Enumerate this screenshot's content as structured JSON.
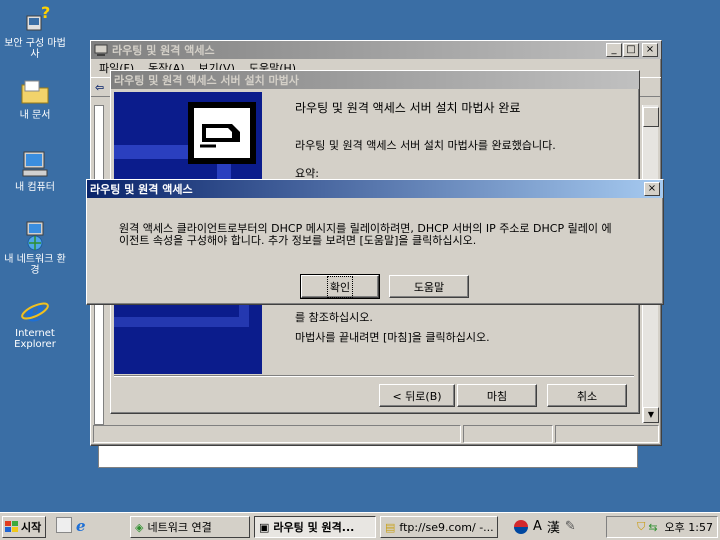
{
  "desktop": {
    "icons": [
      {
        "label": "보안 구성 마법사"
      },
      {
        "label": "내 문서"
      },
      {
        "label": "내 컴퓨터"
      },
      {
        "label": "내 네트워크 환경"
      },
      {
        "label": "Internet Explorer"
      }
    ]
  },
  "main_window": {
    "title": "라우팅 및 원격 액세스",
    "menu": [
      "파일(F)",
      "동작(A)",
      "보기(V)",
      "도움말(H)"
    ]
  },
  "wizard": {
    "title": "라우팅 및 원격 액세스 서버 설치 마법사",
    "heading": "라우팅 및 원격 액세스 서버 설치 마법사 완료",
    "completed_text": "라우팅 및 원격 액세스 서버 설치 마법사를 완료했습니다.",
    "summary_label": "요약:",
    "partial_line": "를 참조하십시오.",
    "close_text": "마법사를 끝내려면 [마침]을 클릭하십시오.",
    "back_button": "< 뒤로(B)",
    "finish_button": "마침",
    "cancel_button": "취소"
  },
  "dialog": {
    "title": "라우팅 및 원격 액세스",
    "message_line1": "원격 액세스 클라이언트로부터의 DHCP 메시지를 릴레이하려면, DHCP 서버의 IP 주소로 DHCP 릴레이 에",
    "message_line2": "이전트 속성을 구성해야 합니다. 추가 정보를 보려면 [도움말]을 클릭하십시오.",
    "ok_button": "확인",
    "help_button": "도움말"
  },
  "taskbar": {
    "start_label": "시작",
    "tasks": [
      {
        "label": "네트워크 연결"
      },
      {
        "label": "라우팅 및 원격..."
      },
      {
        "label": "ftp://se9.com/ -..."
      }
    ],
    "lang_a": "A",
    "lang_han": "漢",
    "clock": "오후 1:57"
  }
}
